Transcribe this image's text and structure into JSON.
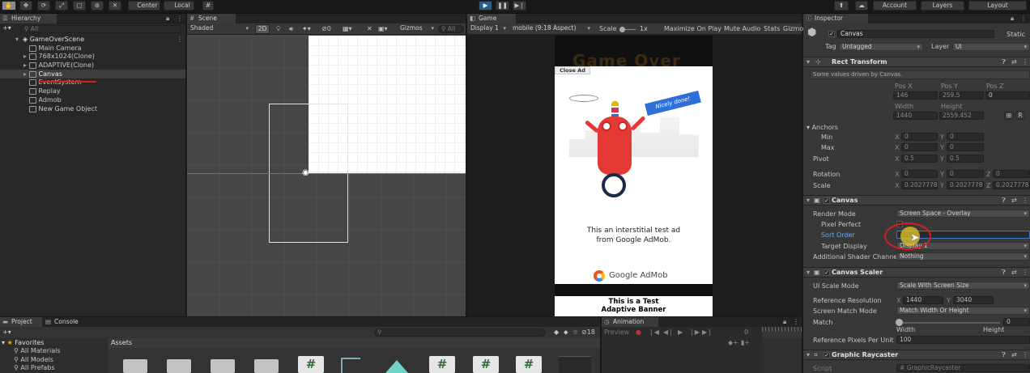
{
  "toolbar": {
    "pivot": "Center",
    "space": "Local",
    "account": "Account",
    "layers": "Layers",
    "layout": "Layout"
  },
  "hierarchy": {
    "tab": "Hierarchy",
    "search_placeholder": "All",
    "scene": "GameOverScene",
    "items": [
      {
        "label": "Main Camera"
      },
      {
        "label": "768x1024(Clone)"
      },
      {
        "label": "ADAPTIVE(Clone)"
      },
      {
        "label": "Canvas"
      },
      {
        "label": "EventSystem"
      },
      {
        "label": "Replay"
      },
      {
        "label": "Admob"
      },
      {
        "label": "New Game Object"
      }
    ]
  },
  "scene": {
    "tab": "Scene",
    "shading": "Shaded",
    "mode2d": "2D",
    "gizmos": "Gizmos",
    "search": "All"
  },
  "game": {
    "tab": "Game",
    "display": "Display 1",
    "aspect": "mobile (9:18 Aspect)",
    "scale_label": "Scale",
    "scale_value": "1x",
    "maximize": "Maximize On Play",
    "mute": "Mute Audio",
    "stats": "Stats",
    "gizmos": "Gizmos",
    "ad": {
      "close": "Close Ad",
      "nicely": "Nicely done!",
      "line1": "This an interstitial test ad",
      "line2": "from Google AdMob.",
      "brand": "Google AdMob",
      "banner1": "This is a Test",
      "banner2": "Adaptive Banner",
      "bg_text": "Game Over"
    }
  },
  "inspector": {
    "tab": "Inspector",
    "object_name": "Canvas",
    "static": "Static",
    "tag_label": "Tag",
    "tag": "Untagged",
    "layer_label": "Layer",
    "layer": "UI",
    "rect": {
      "title": "Rect Transform",
      "note": "Some values driven by Canvas.",
      "pos_x_label": "Pos X",
      "pos_y_label": "Pos Y",
      "pos_z_label": "Pos Z",
      "pos_x": "146",
      "pos_y": "259.5",
      "pos_z": "0",
      "width_label": "Width",
      "height_label": "Height",
      "width": "1440",
      "height": "2559.452",
      "anchors": "Anchors",
      "min": "Min",
      "max": "Max",
      "pivot": "Pivot",
      "min_x": "0",
      "min_y": "0",
      "max_x": "0",
      "max_y": "0",
      "pivot_x": "0.5",
      "pivot_y": "0.5",
      "rotation": "Rotation",
      "rot_x": "0",
      "rot_y": "0",
      "rot_z": "0",
      "scale": "Scale",
      "scale_x": "0.2027778",
      "scale_y": "0.2027778",
      "scale_z": "0.2027778"
    },
    "canvas": {
      "title": "Canvas",
      "render_mode_label": "Render Mode",
      "render_mode": "Screen Space - Overlay",
      "pixel_perfect": "Pixel Perfect",
      "sort_order": "Sort Order",
      "target_display": "Target Display",
      "target_display_value": "Display 1",
      "shader_channels": "Additional Shader Channels",
      "shader_channels_value": "Nothing"
    },
    "scaler": {
      "title": "Canvas Scaler",
      "ui_scale_mode_label": "UI Scale Mode",
      "ui_scale_mode": "Scale With Screen Size",
      "ref_res_label": "Reference Resolution",
      "ref_x": "1440",
      "ref_y": "3040",
      "match_mode_label": "Screen Match Mode",
      "match_mode": "Match Width Or Height",
      "match_label": "Match",
      "match_value": "0",
      "width": "Width",
      "height": "Height",
      "ppu_label": "Reference Pixels Per Unit",
      "ppu": "100"
    },
    "raycaster": {
      "title": "Graphic Raycaster",
      "script_label": "Script",
      "script": "GraphicRaycaster"
    }
  },
  "project": {
    "tab": "Project",
    "console_tab": "Console",
    "favorites": "Favorites",
    "fav_items": [
      {
        "label": "All Materials"
      },
      {
        "label": "All Models"
      },
      {
        "label": "All Prefabs"
      }
    ],
    "assets": "Assets",
    "hidden_count": "18"
  },
  "animation": {
    "tab": "Animation",
    "preview": "Preview",
    "frame": "0"
  },
  "colors": {
    "accent": "#2c5d87",
    "play": "#4a8fd4"
  }
}
